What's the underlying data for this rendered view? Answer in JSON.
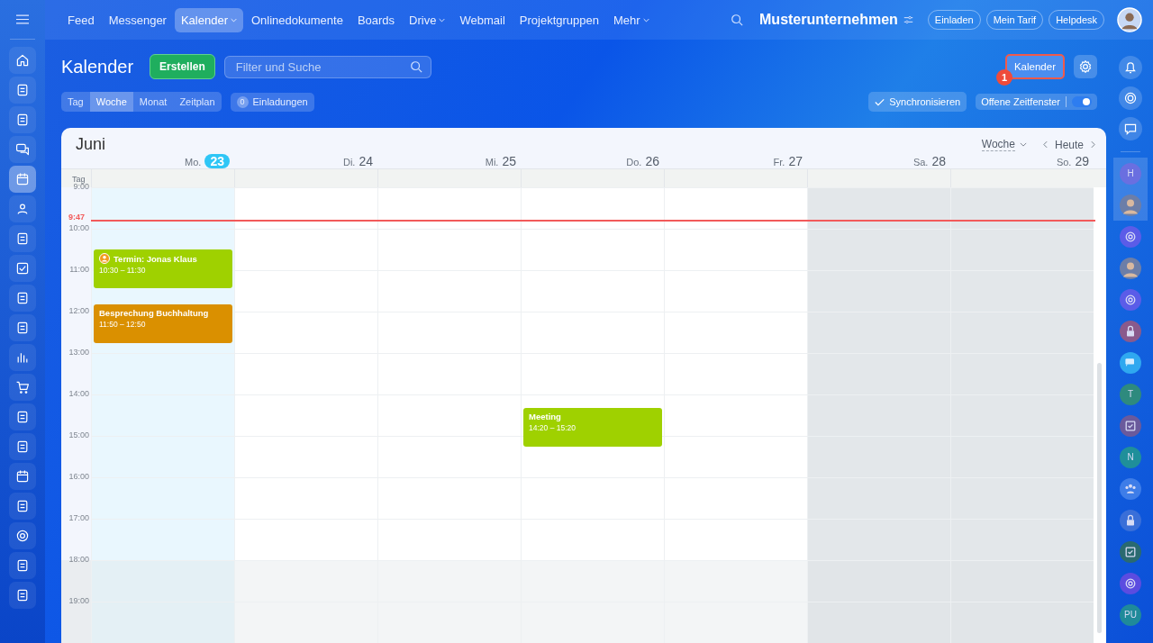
{
  "top_nav": {
    "items": [
      {
        "label": "Feed",
        "selected": false,
        "menu": false
      },
      {
        "label": "Messenger",
        "selected": false,
        "menu": false
      },
      {
        "label": "Kalender",
        "selected": true,
        "menu": true
      },
      {
        "label": "Onlinedokumente",
        "selected": false,
        "menu": false
      },
      {
        "label": "Boards",
        "selected": false,
        "menu": false
      },
      {
        "label": "Drive",
        "selected": false,
        "menu": true
      },
      {
        "label": "Webmail",
        "selected": false,
        "menu": false
      },
      {
        "label": "Projektgruppen",
        "selected": false,
        "menu": false
      },
      {
        "label": "Mehr",
        "selected": false,
        "menu": true
      }
    ],
    "company": "Musterunternehmen",
    "buttons": [
      "Einladen",
      "Mein Tarif",
      "Helpdesk"
    ]
  },
  "left_sidebar": {
    "items": [
      {
        "selected": false
      },
      {
        "selected": false
      },
      {
        "selected": false
      },
      {
        "selected": false
      },
      {
        "selected": true
      },
      {
        "selected": false
      },
      {
        "selected": false
      },
      {
        "selected": false
      },
      {
        "selected": false
      },
      {
        "selected": false
      },
      {
        "selected": false
      },
      {
        "selected": false
      },
      {
        "selected": false
      },
      {
        "selected": false
      },
      {
        "selected": false
      },
      {
        "selected": false
      },
      {
        "selected": false
      },
      {
        "selected": false
      },
      {
        "selected": false
      }
    ]
  },
  "header": {
    "title": "Kalender",
    "create_button": "Erstellen",
    "search": {
      "placeholder": "Filter und Suche"
    },
    "calendar_button": {
      "label": "Kalender",
      "highlighted": true,
      "callout": "1"
    }
  },
  "view_tabs": [
    {
      "label": "Tag",
      "selected": false
    },
    {
      "label": "Woche",
      "selected": true
    },
    {
      "label": "Monat",
      "selected": false
    },
    {
      "label": "Zeitplan",
      "selected": false
    }
  ],
  "invitations": {
    "count": "0",
    "label": "Einladungen"
  },
  "sync_button": "Synchronisieren",
  "open_slots": {
    "label": "Offene Zeitfenster",
    "on": true
  },
  "calendar": {
    "month": "Juni",
    "view_select": "Woche",
    "today_button": "Heute",
    "allday_label": "Tag",
    "current_time": "9:47",
    "days": [
      {
        "name": "Mo.",
        "number": "23",
        "today": true,
        "weekend": false,
        "events": [
          {
            "kind": "appointment",
            "title": "Termin: Jonas Klaus",
            "time": "10:30 – 11:30",
            "color": "#9fd100"
          },
          {
            "kind": "event",
            "title": "Besprechung Buchhaltung",
            "time": "11:50 – 12:50",
            "color": "#da9000"
          }
        ]
      },
      {
        "name": "Di.",
        "number": "24",
        "today": false,
        "weekend": false
      },
      {
        "name": "Mi.",
        "number": "25",
        "today": false,
        "weekend": false
      },
      {
        "name": "Do.",
        "number": "26",
        "today": false,
        "weekend": false,
        "events": [
          {
            "kind": "event",
            "title": "Meeting",
            "time": "14:20 – 15:20",
            "color": "#9fd100"
          }
        ]
      },
      {
        "name": "Fr.",
        "number": "27",
        "today": false,
        "weekend": false
      },
      {
        "name": "Sa.",
        "number": "28",
        "today": false,
        "weekend": true
      },
      {
        "name": "So.",
        "number": "29",
        "today": false,
        "weekend": true
      }
    ],
    "hours": [
      {
        "label": "9:00",
        "off": false
      },
      {
        "label": "10:00",
        "off": false
      },
      {
        "label": "11:00",
        "off": false
      },
      {
        "label": "12:00",
        "off": false
      },
      {
        "label": "13:00",
        "off": false
      },
      {
        "label": "14:00",
        "off": false
      },
      {
        "label": "15:00",
        "off": false
      },
      {
        "label": "16:00",
        "off": false
      },
      {
        "label": "17:00",
        "off": false
      },
      {
        "label": "18:00",
        "off": true
      },
      {
        "label": "19:00",
        "off": true
      }
    ]
  },
  "right_sidebar": {
    "items": [
      {
        "kind": "initial",
        "text": "H",
        "color": "#6a6fe0",
        "grouped": true
      },
      {
        "kind": "photo",
        "grouped": true
      },
      {
        "kind": "copilot",
        "color": "#5b5ce8",
        "grouped": false
      },
      {
        "kind": "photo",
        "grouped": false
      },
      {
        "kind": "copilot",
        "color": "#5b5ce8",
        "grouped": false
      },
      {
        "kind": "lock",
        "color": "#8a5a8c",
        "grouped": false
      },
      {
        "kind": "chat",
        "color": "#2fa8f0",
        "grouped": false
      },
      {
        "kind": "initial",
        "text": "T",
        "color": "#2e8a7e",
        "grouped": false
      },
      {
        "kind": "task",
        "color": "#6a5a9c",
        "grouped": false
      },
      {
        "kind": "initial",
        "text": "N",
        "color": "#1f8f9a",
        "grouped": false
      },
      {
        "kind": "group",
        "color": "#3e7de8",
        "grouped": false
      },
      {
        "kind": "lock",
        "color": "#3a6fd8",
        "grouped": false
      },
      {
        "kind": "task",
        "color": "#2a6a70",
        "grouped": false
      },
      {
        "kind": "copilot",
        "color": "#5b4ce0",
        "grouped": false
      },
      {
        "kind": "initial",
        "text": "PU",
        "color": "#1f8a9a",
        "grouped": false
      }
    ]
  }
}
